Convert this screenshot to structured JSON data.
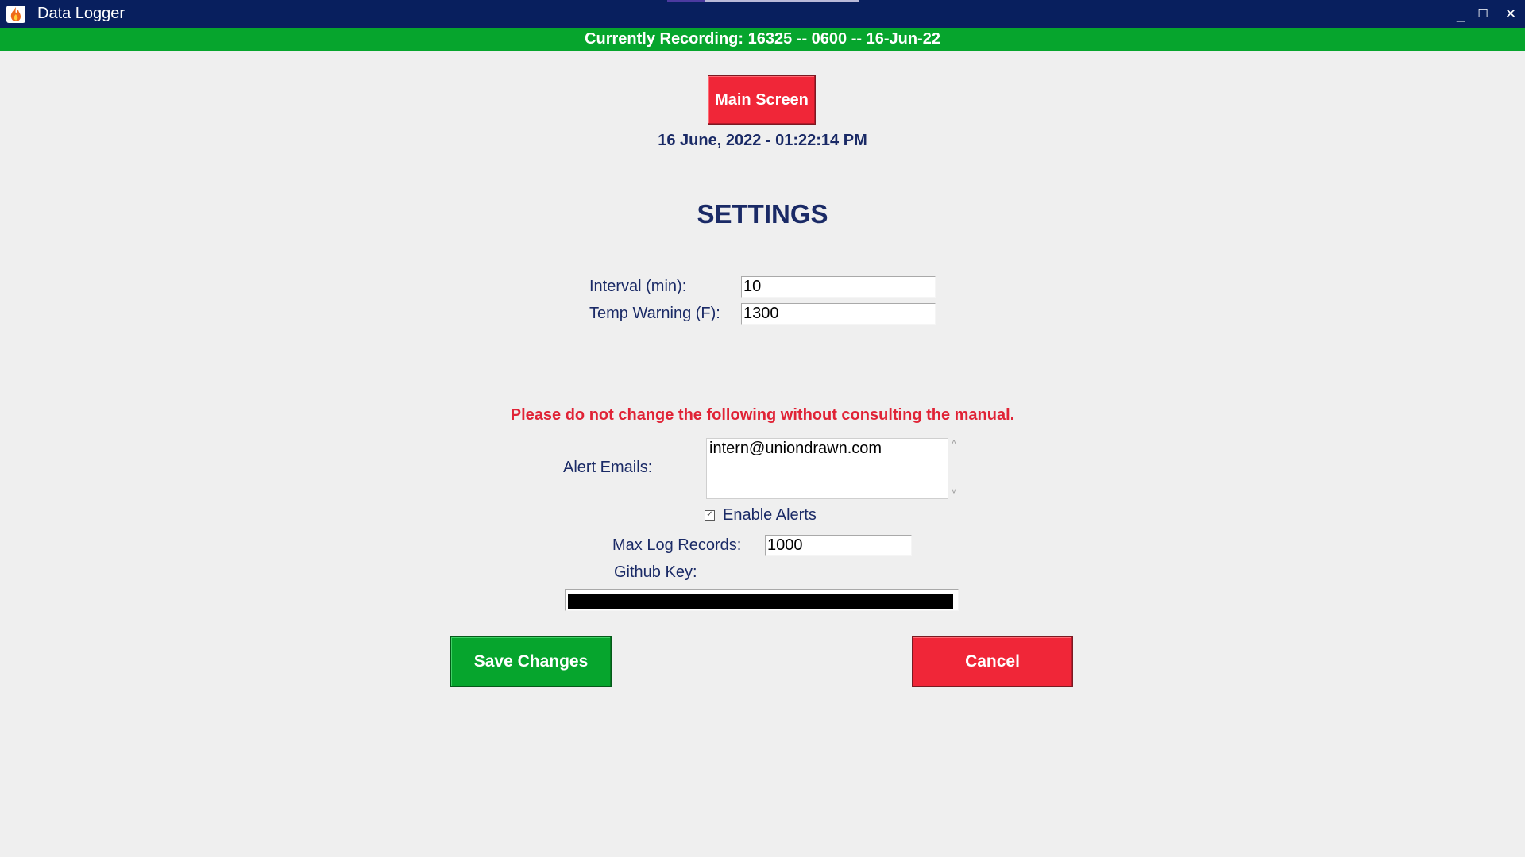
{
  "window": {
    "title": "Data Logger",
    "icon": "flame-icon",
    "controls": {
      "minimize": "_",
      "maximize": "☐",
      "close": "✕"
    }
  },
  "recording_bar": {
    "text": "Currently Recording: 16325 -- 0600 -- 16-Jun-22",
    "color": "#06a52d"
  },
  "main_screen_button": {
    "label": "Main Screen",
    "color": "#f02638"
  },
  "datetime": "16 June, 2022 - 01:22:14 PM",
  "settings": {
    "title": "SETTINGS",
    "interval": {
      "label": "Interval (min):",
      "value": "10"
    },
    "temp_warning": {
      "label": "Temp Warning (F):",
      "value": "1300"
    }
  },
  "advanced": {
    "warning": "Please do not change the following without consulting the manual.",
    "alert_emails": {
      "label": "Alert Emails:",
      "value": "intern@uniondrawn.com"
    },
    "enable_alerts": {
      "label": "Enable Alerts",
      "checked": true
    },
    "max_log_records": {
      "label": "Max Log Records:",
      "value": "1000"
    },
    "github_key": {
      "label": "Github Key:",
      "masked": true
    }
  },
  "actions": {
    "save_label": "Save Changes",
    "cancel_label": "Cancel"
  },
  "colors": {
    "titlebar": "#081f5e",
    "text_navy": "#1a2a66",
    "warning_red": "#e02336",
    "green": "#06a52d",
    "red": "#f02638"
  }
}
